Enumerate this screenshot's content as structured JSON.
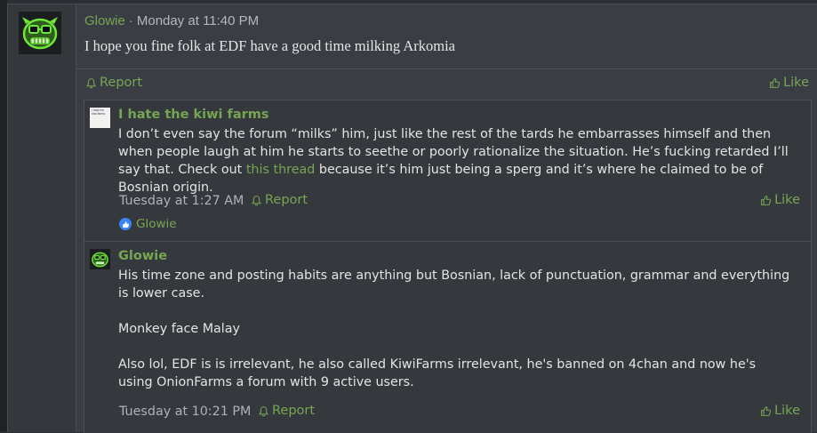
{
  "post": {
    "author": "Glowie",
    "timestamp": "Monday at 11:40 PM",
    "separator": "·",
    "body": "I hope you fine folk at EDF have a good time milking Arkomia",
    "report_label": "Report",
    "like_label": "Like"
  },
  "replies": [
    {
      "author": "I hate the kiwi farms",
      "avatar_text": "I hate the kiwi farms",
      "text_before_link": "I don’t even say the forum “milks” him, just like the rest of the tards he embarrasses himself and then when people laugh at him he starts to seethe or poorly rationalize the situation. He’s fucking retarded I’ll say that. Check out ",
      "link_text": "this thread",
      "text_after_link": " because it’s him just being a sperg and it’s where he claimed to be of Bosnian origin.",
      "timestamp": "Tuesday at 1:27 AM",
      "report_label": "Report",
      "like_label": "Like",
      "reaction_user": "Glowie"
    },
    {
      "author": "Glowie",
      "paragraphs": [
        "His time zone and posting habits are anything but Bosnian, lack of punctuation, grammar and everything is lower case.",
        "Monkey face Malay",
        "Also lol, EDF is is irrelevant, he also called KiwiFarms irrelevant, he's banned on 4chan and now he's using OnionFarms a forum with 9 active users."
      ],
      "timestamp": "Tuesday at 10:21 PM",
      "report_label": "Report",
      "like_label": "Like"
    }
  ],
  "colors": {
    "accent": "#76a652",
    "background": "#2b2e33",
    "post_bg": "#3a3d43",
    "reaction_badge": "#3b82f6"
  },
  "icons": {
    "report": "bell-alert-icon",
    "like": "thumbs-up-icon",
    "reaction": "thumbs-up-reaction-icon"
  }
}
